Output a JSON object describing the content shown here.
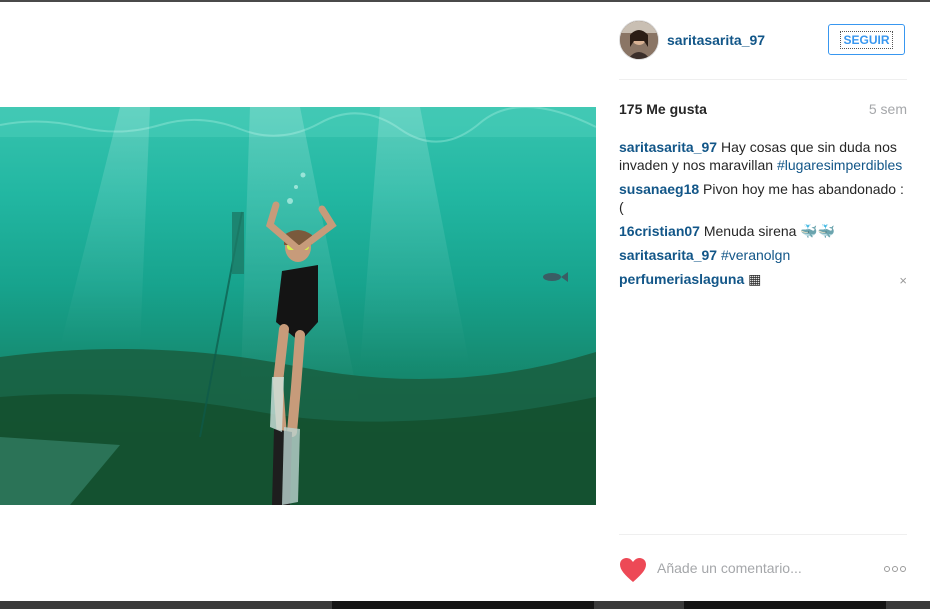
{
  "post": {
    "username": "saritasarita_97",
    "follow_label": "SEGUIR",
    "likes": "175 Me gusta",
    "age": "5 sem",
    "comments": [
      {
        "user": "saritasarita_97",
        "text": " Hay cosas que sin duda nos invaden y nos maravillan ",
        "tag": "#lugaresimperdibles"
      },
      {
        "user": "susanaeg18",
        "text": " Pivon hoy me has abandonado :(",
        "tag": ""
      },
      {
        "user": "16cristian07",
        "text": " Menuda sirena 🐳🐳",
        "tag": ""
      },
      {
        "user": "saritasarita_97",
        "text": " ",
        "tag": "#veranolgn"
      },
      {
        "user": "perfumeriaslaguna",
        "text": " ▦",
        "tag": ""
      }
    ],
    "remove_comment_glyph": "×",
    "comment_placeholder": "Añade un comentario..."
  },
  "icons": {
    "like": "heart-icon",
    "more": "more-options-icon",
    "remove": "close-icon"
  },
  "colors": {
    "username": "#125688",
    "follow_accent": "#3897f0",
    "heart": "#ed4956",
    "muted": "#a5a7aa"
  }
}
